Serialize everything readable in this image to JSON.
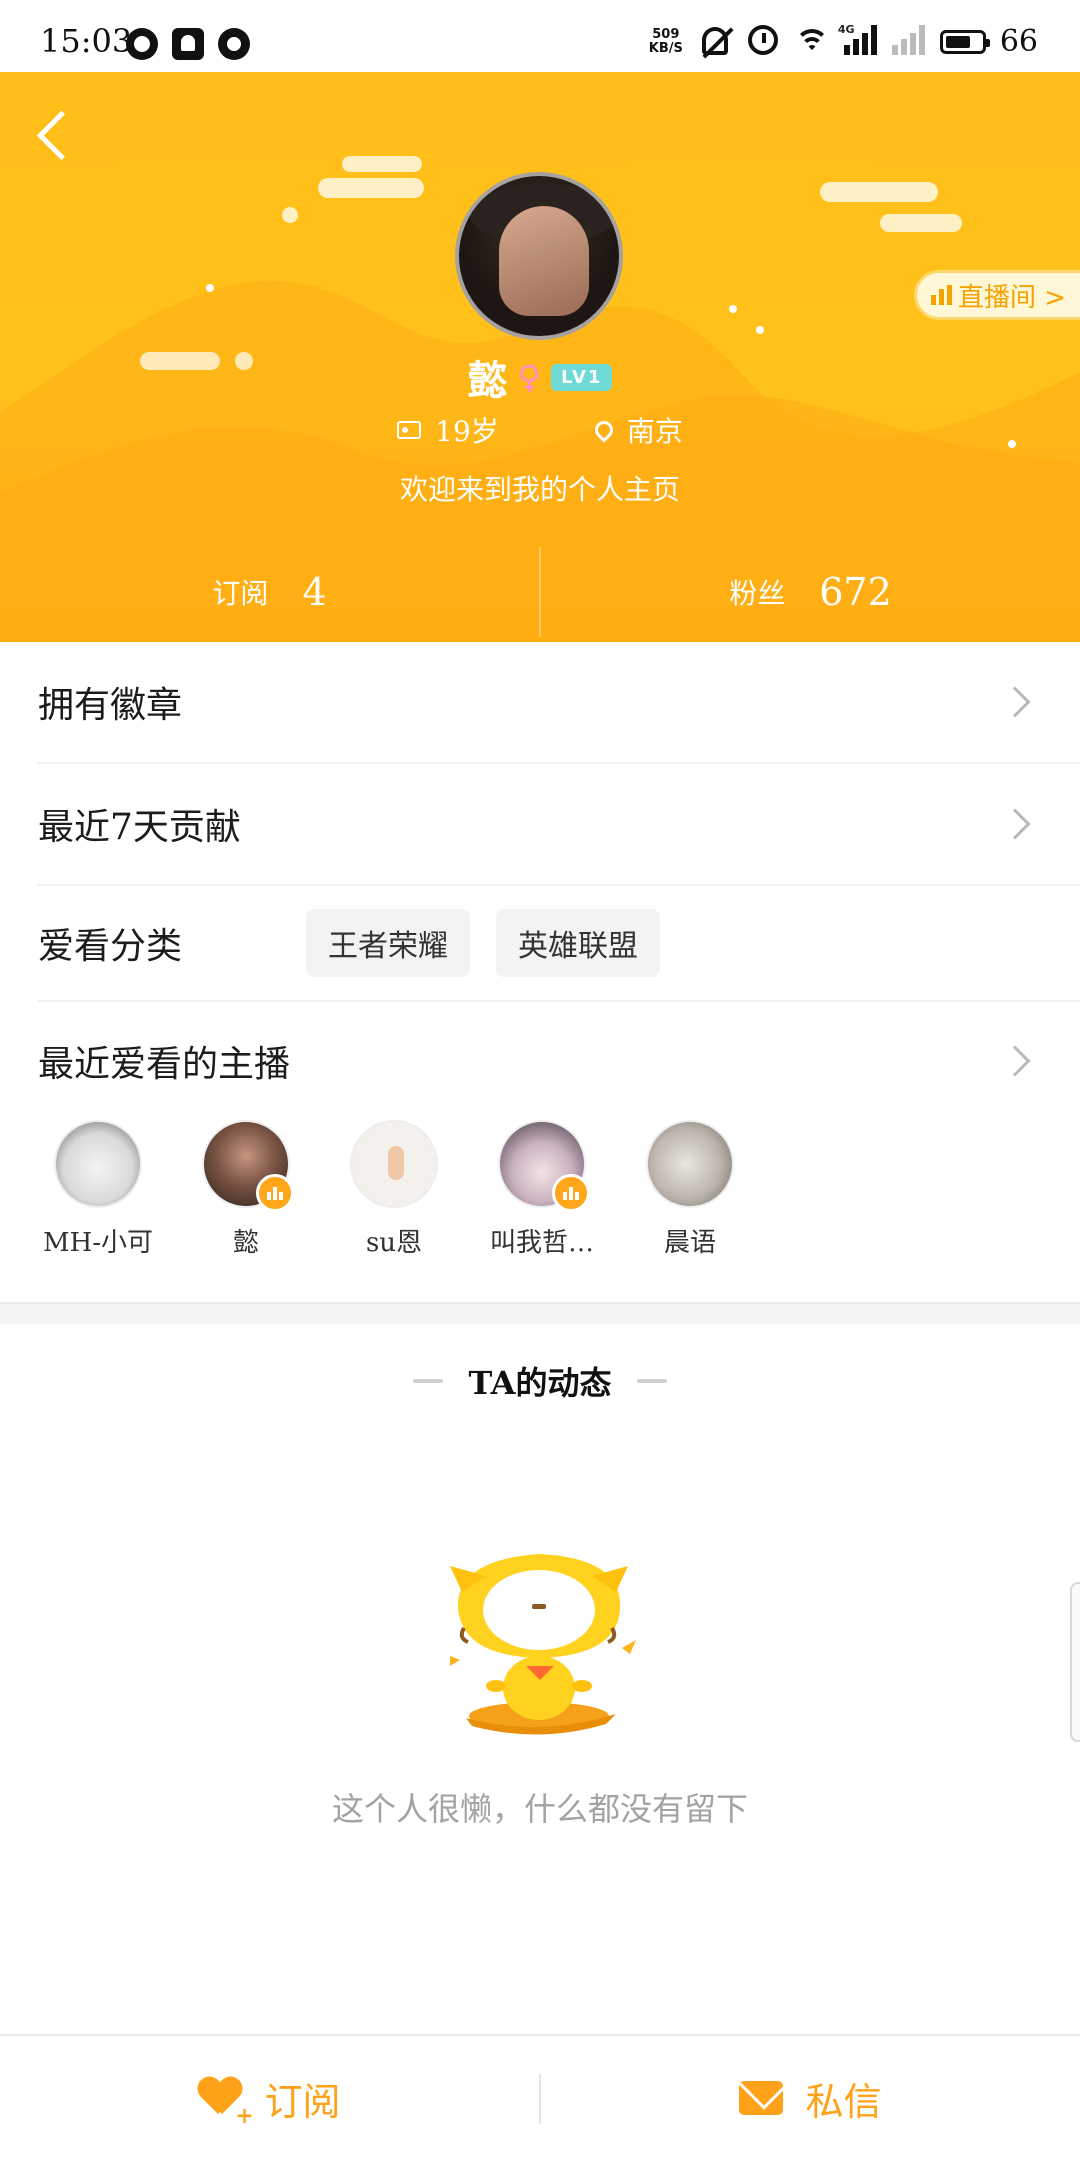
{
  "status_bar": {
    "time": "15:03",
    "net_speed_value": "509",
    "net_speed_unit": "KB/S",
    "network_label": "4G",
    "battery": "66",
    "battery_level": 0.66,
    "icons": [
      "qq-icon",
      "snapchat-icon",
      "app-icon",
      "net-speed",
      "mute-bell-icon",
      "alarm-icon",
      "wifi-icon",
      "signal-icon",
      "signal-empty-icon",
      "battery-icon"
    ]
  },
  "header": {
    "back_icon": "chevron-left-icon",
    "live_room_label": "直播间 >",
    "username": "懿",
    "gender_symbol": "♀",
    "level": "LV1",
    "age": "19岁",
    "location": "南京",
    "bio": "欢迎来到我的个人主页",
    "colors": {
      "primary": "#ffbe18",
      "accent": "#f5a100",
      "gender": "#ff8cc6",
      "level_badge": "#6fd9d5"
    }
  },
  "stats": {
    "subscribe_label": "订阅",
    "subscribe_count": "4",
    "fans_label": "粉丝",
    "fans_count": "672"
  },
  "menu": {
    "badges": "拥有徽章",
    "recent_contribution": "最近7天贡献",
    "favorite_categories_label": "爱看分类",
    "favorite_categories": [
      "王者荣耀",
      "英雄联盟"
    ],
    "favorite_streamers_label": "最近爱看的主播"
  },
  "streamers": [
    {
      "name": "MH-小可",
      "live": false
    },
    {
      "name": "懿",
      "live": true
    },
    {
      "name": "su恩",
      "live": false
    },
    {
      "name": "叫我哲…",
      "live": true
    },
    {
      "name": "晨语",
      "live": false
    }
  ],
  "feed": {
    "title": "TA的动态",
    "empty_text": "这个人很懒，什么都没有留下"
  },
  "bottom_bar": {
    "subscribe_label": "订阅",
    "message_label": "私信"
  }
}
